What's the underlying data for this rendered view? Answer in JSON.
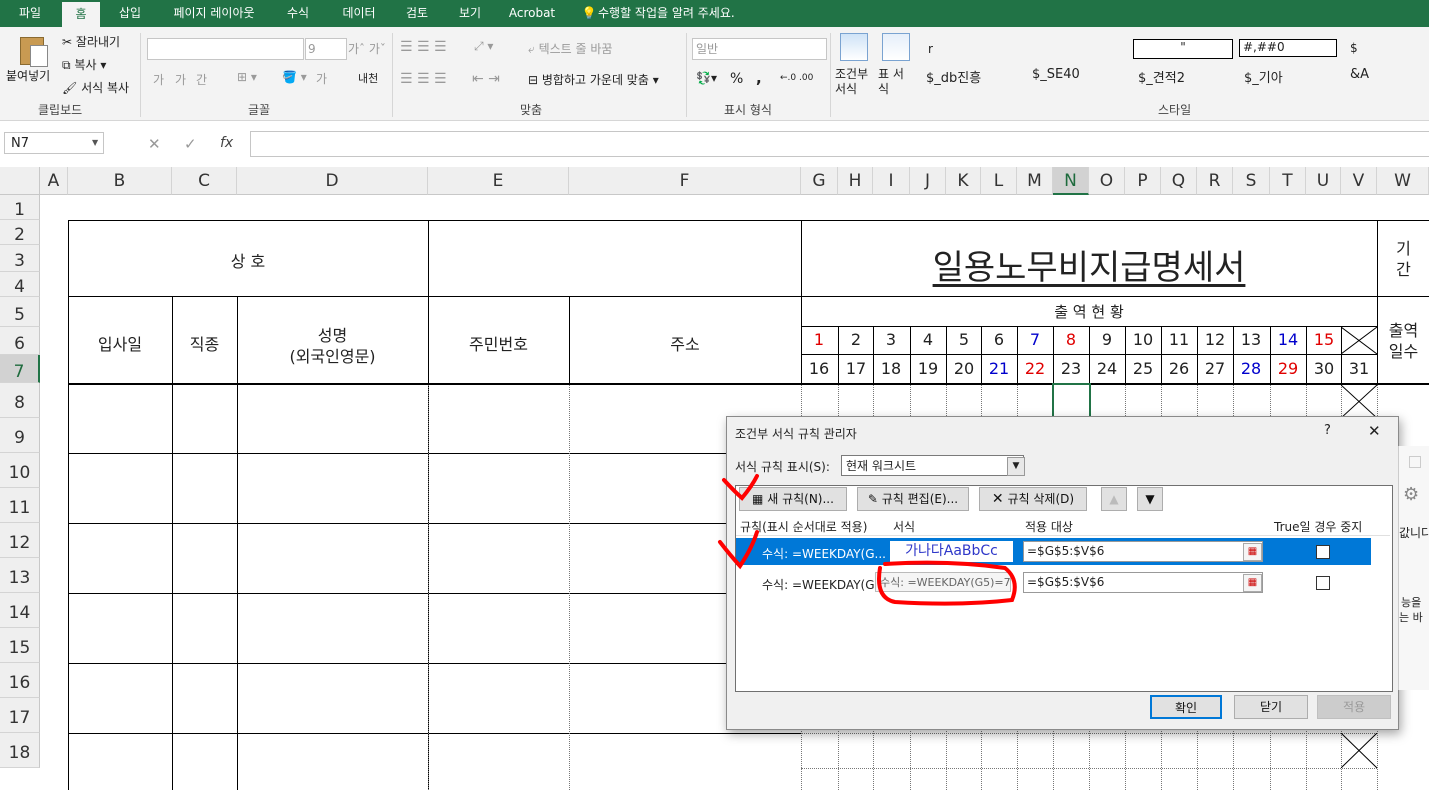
{
  "ribbon_tabs": [
    "파일",
    "홈",
    "삽입",
    "페이지 레이아웃",
    "수식",
    "데이터",
    "검토",
    "보기",
    "Acrobat"
  ],
  "tell_me": "수행할 작업을 알려 주세요.",
  "clipboard": {
    "paste": "붙여넣기",
    "cut": "잘라내기",
    "copy": "복사",
    "format_painter": "서식 복사",
    "label": "클립보드"
  },
  "font": {
    "size": "9",
    "bold": "가",
    "italic": "가",
    "underline": "간",
    "text_color": "가",
    "phonetic": "내천",
    "label": "글꼴"
  },
  "alignment": {
    "wrap": "텍스트 줄 바꿈",
    "merge": "병합하고 가운데 맞춤",
    "label": "맞춤"
  },
  "number": {
    "format": "일반",
    "percent": "%",
    "comma": ",",
    "inc": "←.0 .00",
    "dec": ".00 →.0",
    "label": "표시 형식"
  },
  "styles": {
    "conditional": "조건부 서식",
    "table": "표 서식",
    "cells": [
      "r",
      "\"",
      "#,##0",
      "$",
      "$_db진흥",
      "$_SE40",
      "$_견적2",
      "$_기아",
      "&A"
    ],
    "label": "스타일"
  },
  "formula_bar": {
    "name_box": "N7",
    "cancel": "✕",
    "enter": "✓",
    "fx": "fx",
    "content": ""
  },
  "columns": [
    "A",
    "B",
    "C",
    "D",
    "E",
    "F",
    "G",
    "H",
    "I",
    "J",
    "K",
    "L",
    "M",
    "N",
    "O",
    "P",
    "Q",
    "R",
    "S",
    "T",
    "U",
    "V",
    "W"
  ],
  "rows": [
    "1",
    "2",
    "3",
    "4",
    "5",
    "6",
    "7",
    "8",
    "9",
    "10",
    "11",
    "12",
    "13",
    "14",
    "15",
    "16",
    "17",
    "18"
  ],
  "sheet": {
    "company_label": "상   호",
    "title": "일용노무비지급명세서",
    "attendance_label": "출   역   현   황",
    "period_label": "기\n간",
    "join_date": "입사일",
    "job_type": "직종",
    "name_line1": "성명",
    "name_line2": "(외국인영문)",
    "resident_no": "주민번호",
    "address": "주소",
    "days_label": "출역\n일수",
    "days_row1": [
      "1",
      "2",
      "3",
      "4",
      "5",
      "6",
      "7",
      "8",
      "9",
      "10",
      "11",
      "12",
      "13",
      "14",
      "15"
    ],
    "days_row2": [
      "16",
      "17",
      "18",
      "19",
      "20",
      "21",
      "22",
      "23",
      "24",
      "25",
      "26",
      "27",
      "28",
      "29",
      "30",
      "31"
    ],
    "red_days": [
      "1",
      "8",
      "15",
      "22",
      "29"
    ],
    "blue_days": [
      "7",
      "14",
      "21",
      "28"
    ],
    "red_color": "#e00000",
    "blue_color": "#0000cc"
  },
  "dialog": {
    "title": "조건부 서식 규칙 관리자",
    "help": "?",
    "close": "✕",
    "show_rules_label": "서식 규칙 표시(S):",
    "show_rules_value": "현재 워크시트",
    "new_rule": "새 규칙(N)...",
    "edit_rule": "규칙 편집(E)...",
    "delete_rule": "규칙 삭제(D)",
    "col_rule": "규칙(표시 순서대로 적용)",
    "col_format": "서식",
    "col_applies": "적용 대상",
    "col_stop": "True일 경우 중지",
    "rules": [
      {
        "rule": "수식: =WEEKDAY(G...",
        "format": "가나다AaBbCc",
        "applies": "=$G$5:$V$6"
      },
      {
        "rule": "수식: =WEEKDAY(G...",
        "format": "",
        "applies": "=$G$5:$V$6"
      }
    ],
    "tooltip": "수식: =WEEKDAY(G5)=7",
    "ok": "확인",
    "cancel": "닫기",
    "apply": "적용"
  },
  "background_panel": {
    "text1": "값니다",
    "text2": "능을",
    "text3": "는 바"
  }
}
